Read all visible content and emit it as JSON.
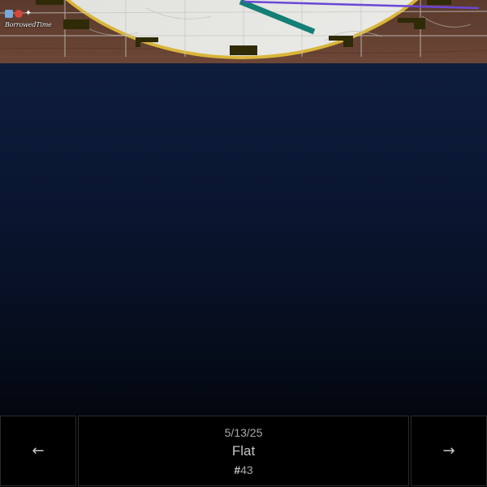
{
  "watermark": {
    "text": "BorrowedTime",
    "icons": [
      "mail-icon",
      "heart-icon",
      "sparkle-icon"
    ]
  },
  "clock": {
    "hands": [
      "teal-hand",
      "purple-hand"
    ],
    "colors": {
      "rim": "#d9b53a",
      "face": "#e9e9e6",
      "teal_hand": "#137f76",
      "purple_hand": "#6a47d6",
      "numeral": "#2f2a08",
      "wood": "#5e3c2d"
    }
  },
  "colors": {
    "panel_top": "#0e1d3c",
    "panel_bottom": "#03070f",
    "nav_border": "#2b2b2b"
  },
  "nav": {
    "prev_icon": "←",
    "next_icon": "→",
    "date": "5/13/25",
    "title": "Flat",
    "number_prefix": "#",
    "number": "43"
  }
}
